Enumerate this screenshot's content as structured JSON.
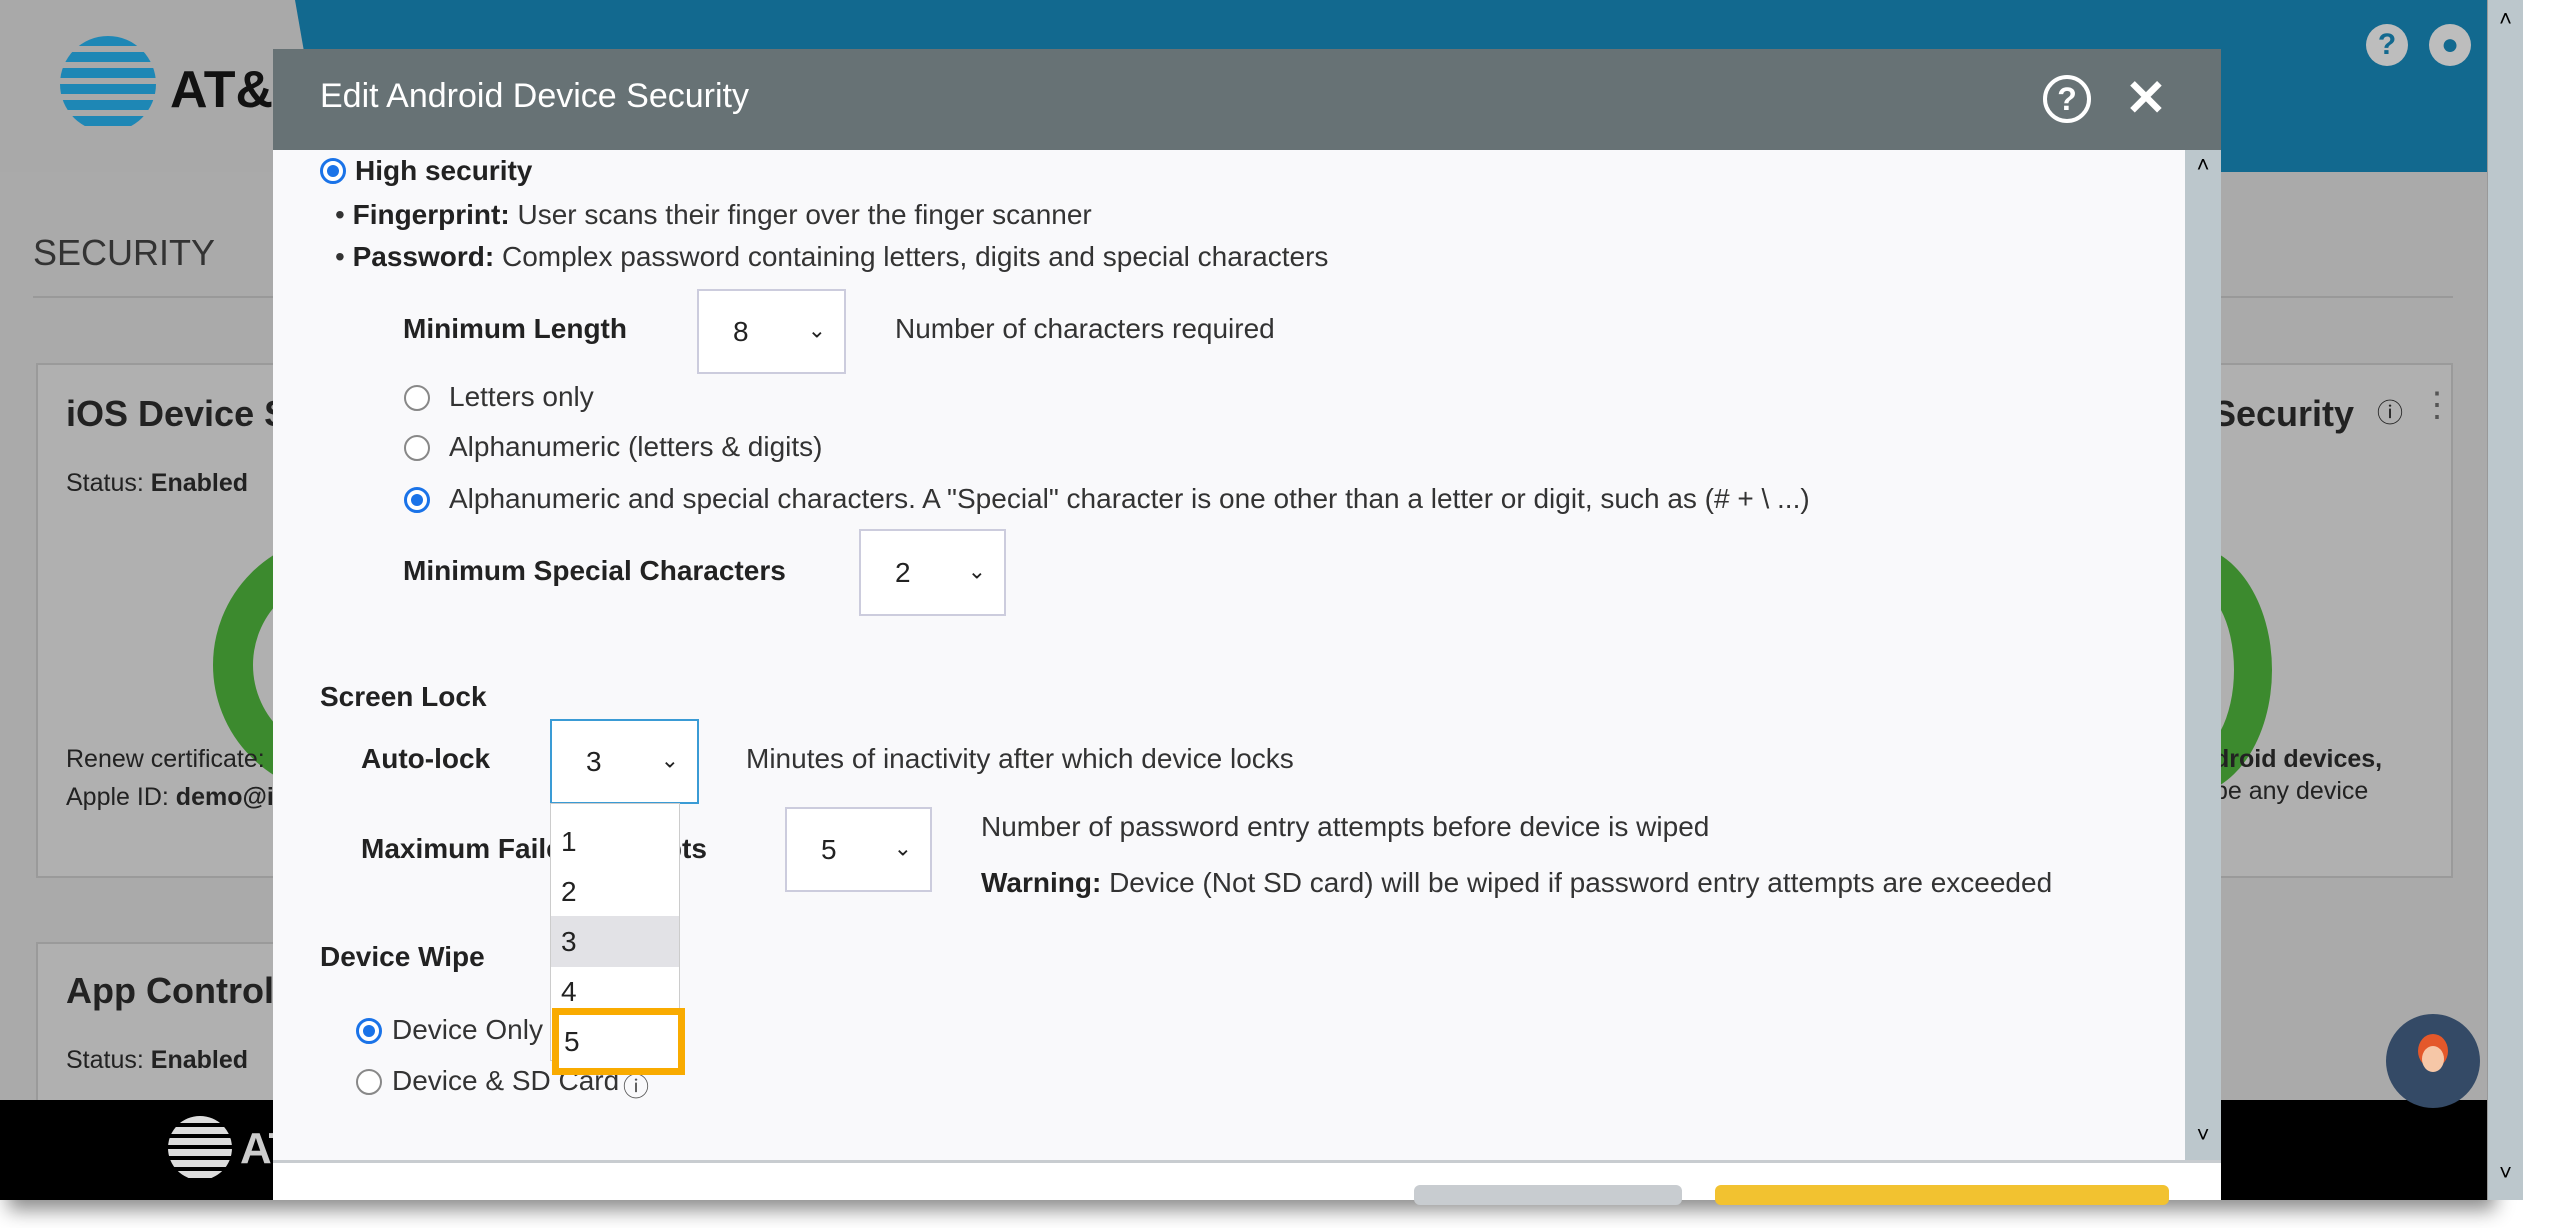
{
  "app": {
    "brand": "AT&T",
    "section_title": "SECURITY"
  },
  "background": {
    "ios_card": {
      "title": "iOS Device S",
      "status_label": "Status:",
      "status_value": "Enabled",
      "renew": "Renew certificate: ",
      "apple_id_label": "Apple ID:",
      "apple_id_value": "demo@i"
    },
    "android_card": {
      "title": "Security",
      "line1": "droid devices,",
      "line2": "pe any device"
    },
    "app_control_card": {
      "title": "App Control",
      "status_label": "Status:",
      "status_value": "Enabled"
    },
    "footer_brand": "AT"
  },
  "modal": {
    "title": "Edit Android Device Security",
    "help": "?",
    "close": "✕",
    "high_security": "High security",
    "bullets": [
      {
        "label": "Fingerprint:",
        "text": "User scans their finger over the finger scanner"
      },
      {
        "label": "Password:",
        "text": "Complex password containing letters, digits and special characters"
      }
    ],
    "min_length": {
      "label": "Minimum Length",
      "value": "8",
      "hint": "Number of characters required"
    },
    "char_options": [
      {
        "label": "Letters only",
        "selected": false
      },
      {
        "label": "Alphanumeric (letters & digits)",
        "selected": false
      },
      {
        "label": "Alphanumeric and special characters. A \"Special\" character is one other than a letter or digit, such as  (# + \\ ...)",
        "selected": true
      }
    ],
    "min_special": {
      "label": "Minimum Special Characters",
      "value": "2"
    },
    "screen_lock": {
      "heading": "Screen Lock",
      "auto_lock_label": "Auto-lock",
      "auto_lock_value": "3",
      "auto_lock_hint": "Minutes of inactivity after which device locks",
      "auto_lock_options": [
        "1",
        "2",
        "3",
        "4",
        "5"
      ],
      "highlighted_option": "3",
      "hovered_option": "5"
    },
    "max_failed": {
      "label": "Maximum Failed Attempts",
      "value": "5",
      "hint": "Number of password entry attempts before device is wiped",
      "warning_label": "Warning:",
      "warning_text": "Device (Not SD card) will be wiped if password entry attempts are exceeded"
    },
    "device_wipe": {
      "heading": "Device Wipe",
      "options": [
        {
          "label": "Device Only",
          "selected": true
        },
        {
          "label": "Device & SD Card",
          "selected": false
        }
      ]
    }
  },
  "colors": {
    "header": "#12698f",
    "modal_header": "#677275",
    "accent": "#1a73e8",
    "highlight": "#f9ab00",
    "enabled_green": "#3c8a2e"
  }
}
